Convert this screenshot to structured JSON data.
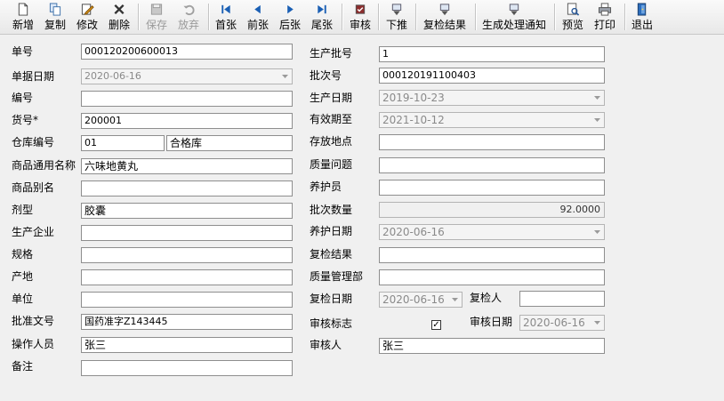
{
  "toolbar": {
    "buttons": [
      {
        "label": "新增",
        "icon": "new-document-icon"
      },
      {
        "label": "复制",
        "icon": "copy-icon"
      },
      {
        "label": "修改",
        "icon": "edit-icon"
      },
      {
        "label": "删除",
        "icon": "delete-x-icon"
      },
      {
        "label": "保存",
        "icon": "save-disk-icon"
      },
      {
        "label": "放弃",
        "icon": "undo-icon"
      },
      {
        "label": "首张",
        "icon": "first-record-icon"
      },
      {
        "label": "前张",
        "icon": "previous-record-icon"
      },
      {
        "label": "后张",
        "icon": "next-record-icon"
      },
      {
        "label": "尾张",
        "icon": "last-record-icon"
      },
      {
        "label": "审核",
        "icon": "audit-stamp-icon"
      },
      {
        "label": "下推",
        "icon": "push-down-icon"
      },
      {
        "label": "复检结果",
        "icon": "recheck-result-icon"
      },
      {
        "label": "生成处理通知",
        "icon": "generate-notice-icon"
      },
      {
        "label": "预览",
        "icon": "preview-icon"
      },
      {
        "label": "打印",
        "icon": "printer-icon"
      },
      {
        "label": "退出",
        "icon": "exit-door-icon"
      }
    ]
  },
  "form": {
    "left": {
      "doc_no": {
        "label": "单号",
        "value": "000120200600013"
      },
      "doc_date": {
        "label": "单据日期",
        "value": "2020-06-16"
      },
      "code": {
        "label": "编号",
        "value": ""
      },
      "item_no": {
        "label": "货号*",
        "value": "200001"
      },
      "warehouse": {
        "label": "仓库编号",
        "code": "01",
        "name": "合格库"
      },
      "generic_name": {
        "label": "商品通用名称",
        "value": "六味地黄丸"
      },
      "alias": {
        "label": "商品别名",
        "value": ""
      },
      "dosage_form": {
        "label": "剂型",
        "value": "胶囊"
      },
      "manufacturer": {
        "label": "生产企业",
        "value": ""
      },
      "spec": {
        "label": "规格",
        "value": ""
      },
      "origin": {
        "label": "产地",
        "value": ""
      },
      "unit": {
        "label": "单位",
        "value": ""
      },
      "approval_no": {
        "label": "批准文号",
        "value": "国药准字Z143445"
      },
      "operator": {
        "label": "操作人员",
        "value": "张三"
      },
      "remark": {
        "label": "备注",
        "value": ""
      }
    },
    "right": {
      "prod_batch": {
        "label": "生产批号",
        "value": "1"
      },
      "batch_no": {
        "label": "批次号",
        "value": "000120191100403"
      },
      "prod_date": {
        "label": "生产日期",
        "value": "2019-10-23"
      },
      "expiry": {
        "label": "有效期至",
        "value": "2021-10-12"
      },
      "location": {
        "label": "存放地点",
        "value": ""
      },
      "quality_issue": {
        "label": "质量问题",
        "value": ""
      },
      "maintainer": {
        "label": "养护员",
        "value": ""
      },
      "batch_qty": {
        "label": "批次数量",
        "value": "92.0000"
      },
      "maint_date": {
        "label": "养护日期",
        "value": "2020-06-16"
      },
      "recheck_result": {
        "label": "复检结果",
        "value": ""
      },
      "qa_dept": {
        "label": "质量管理部",
        "value": ""
      },
      "recheck_date": {
        "label": "复检日期",
        "value": "2020-06-16"
      },
      "rechecker": {
        "label": "复检人",
        "value": ""
      },
      "audit_flag": {
        "label": "审核标志",
        "checked": true,
        "mark": "✓"
      },
      "audit_date": {
        "label": "审核日期",
        "value": "2020-06-16"
      },
      "auditor": {
        "label": "审核人",
        "value": "张三"
      }
    }
  }
}
